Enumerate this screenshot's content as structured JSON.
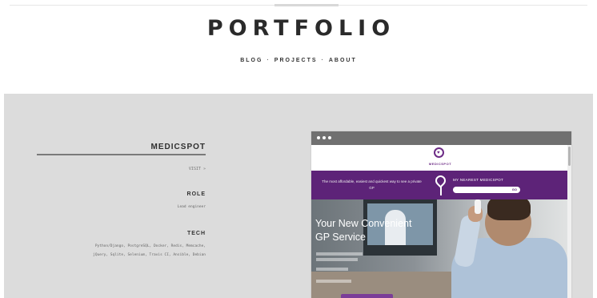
{
  "site": {
    "title": "PORTFOLIO"
  },
  "nav": {
    "items": [
      "BLOG",
      "PROJECTS",
      "ABOUT"
    ],
    "separator": "·"
  },
  "project": {
    "name": "MEDICSPOT",
    "link": "VISIT »",
    "role_heading": "ROLE",
    "role": "Lead engineer",
    "tech_heading": "TECH",
    "tech_line1": "Python/Django, PostgreSQL, Docker, Redis, Memcache,",
    "tech_line2": "jQuery, Sqlite, Selenium, Travis CI, Ansible, Debian"
  },
  "screenshot": {
    "logo_text": "MEDICSPOT",
    "banner_text": "The most affordable, easiest and quickest way to see a private GP",
    "nearest_label": "MY NEAREST MEDICSPOT",
    "nearest_go": "GO",
    "hero_title_1": "Your New Convenient",
    "hero_title_2": "GP Service"
  },
  "colors": {
    "band": "#dcdcdc",
    "brand_purple": "#5d2378",
    "browser_bar": "#707070"
  },
  "icons": {
    "window_dots": "three-dots",
    "logo": "heart-circle-icon",
    "map_pin": "map-pin-icon"
  }
}
